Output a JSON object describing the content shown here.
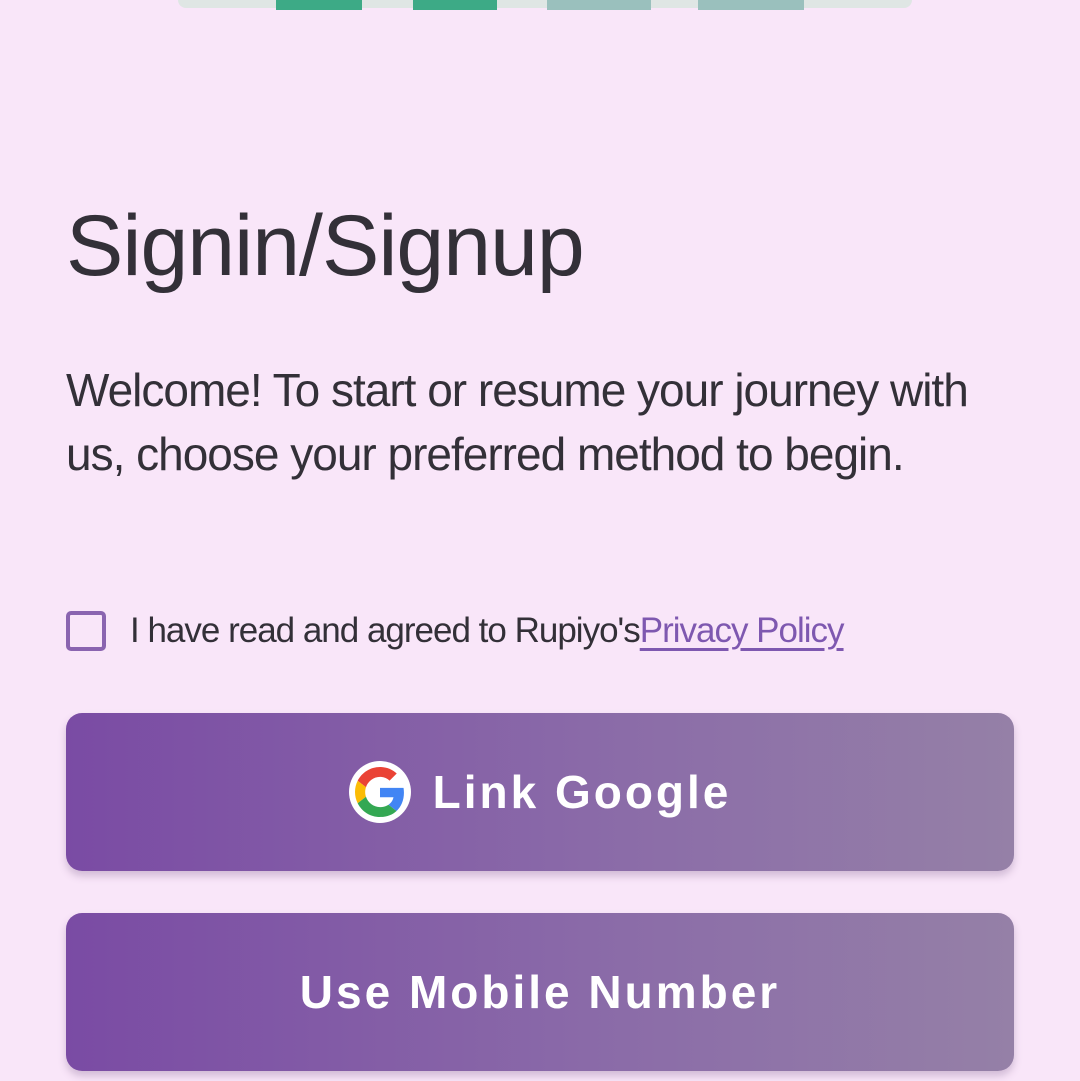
{
  "colors": {
    "background": "#f9e6f9",
    "text": "#333038",
    "accent": "#7e58b0",
    "button_gradient_start": "#7a4ba4",
    "button_gradient_end": "#9580a7",
    "illustration_green": "#3daa86",
    "illustration_teal": "#9ac0bd"
  },
  "auth": {
    "title": "Signin/Signup",
    "subtitle": "Welcome! To start or resume your journey with us, choose your preferred method to begin.",
    "agreement": {
      "checked": false,
      "text": "I have read and agreed to Rupiyo's ",
      "link_label": "Privacy Policy"
    },
    "google_button": {
      "label": "Link Google",
      "icon": "google-logo-icon"
    },
    "mobile_button": {
      "label": "Use Mobile Number"
    }
  }
}
